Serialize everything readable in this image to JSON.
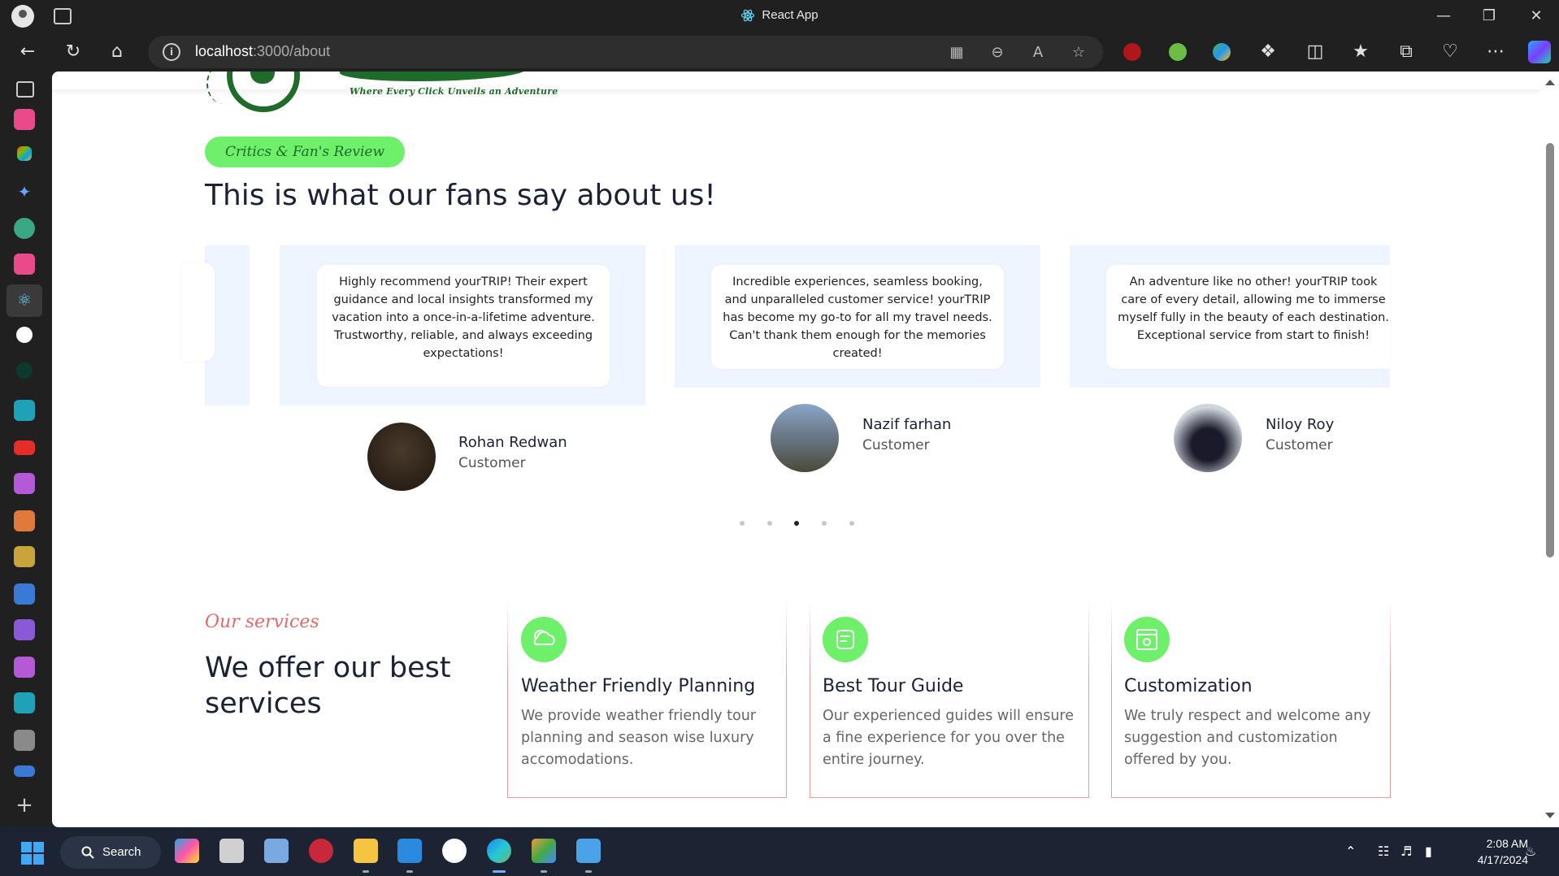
{
  "window": {
    "title": "React App",
    "minimize_icon": "minimize-icon",
    "restore_icon": "restore-icon",
    "close_icon": "close-icon"
  },
  "browser": {
    "url_host": "localhost",
    "url_rest": ":3000/about"
  },
  "page": {
    "logo_tagline": "Where Every Click Unveils an Adventure",
    "reviews": {
      "pill": "Critics & Fan's Review",
      "heading": "This is what our fans say about us!",
      "cards": [
        {
          "quote": "Highly recommend yourTRIP! Their expert guidance and local insights transformed my vacation into a once-in-a-lifetime adventure. Trustworthy, reliable, and always exceeding expectations!",
          "name": "Rohan Redwan",
          "role": "Customer"
        },
        {
          "quote": "Incredible experiences, seamless booking, and unparalleled customer service! yourTRIP has become my go-to for all my travel needs. Can't thank them enough for the memories created!",
          "name": "Nazif farhan",
          "role": "Customer"
        },
        {
          "quote": "An adventure like no other! yourTRIP took care of every detail, allowing me to immerse myself fully in the beauty of each destination. Exceptional service from start to finish!",
          "name": "Niloy Roy",
          "role": "Customer"
        }
      ],
      "dots": 5,
      "active_dot": 3
    },
    "services": {
      "kicker": "Our services",
      "heading": "We offer our best services",
      "cards": [
        {
          "title": "Weather Friendly Planning",
          "desc": "We provide weather friendly tour planning and season wise luxury accomodations.",
          "icon": "weather-icon"
        },
        {
          "title": "Best Tour Guide",
          "desc": "Our experienced guides will ensure a fine experience for you over the entire journey.",
          "icon": "guide-icon"
        },
        {
          "title": "Customization",
          "desc": "We truly respect and welcome any suggestion and customization offered by you.",
          "icon": "customization-icon"
        }
      ]
    }
  },
  "taskbar": {
    "search_label": "Search",
    "time": "2:08 AM",
    "date": "4/17/2024"
  },
  "colors": {
    "accent_green": "#6ff06a",
    "brand_green": "#1e6b2a",
    "service_border": "#e99a9a",
    "kicker_red": "#e26a6a",
    "card_bg": "#eef5ff"
  }
}
